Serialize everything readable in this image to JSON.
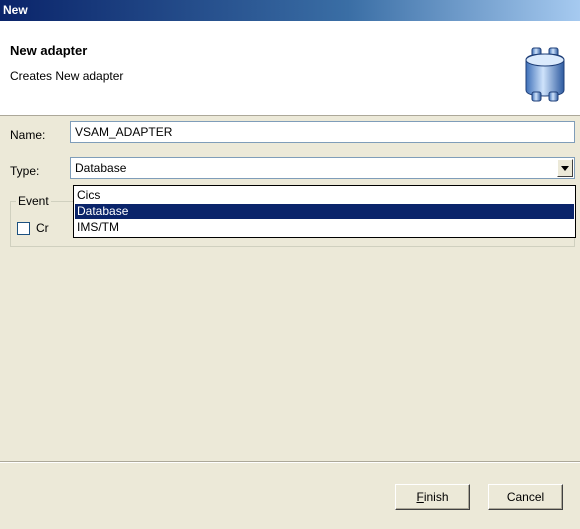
{
  "window": {
    "title": "New"
  },
  "header": {
    "title": "New adapter",
    "description": "Creates New adapter",
    "icon": "database-cylinder-icon"
  },
  "form": {
    "name_label": "Name:",
    "name_value": "VSAM_ADAPTER",
    "type_label": "Type:",
    "type_value": "Database",
    "type_options": [
      "Cics",
      "Database",
      "IMS/TM"
    ],
    "group_legend": "Event",
    "checkbox_label": "Cr",
    "checkbox_checked": false
  },
  "footer": {
    "finish_label": "Finish",
    "cancel_label": "Cancel"
  },
  "colors": {
    "titlebar_start": "#0a246a",
    "titlebar_end": "#a6caf0",
    "selection": "#0a246a",
    "dialog_bg": "#ece9d8"
  }
}
